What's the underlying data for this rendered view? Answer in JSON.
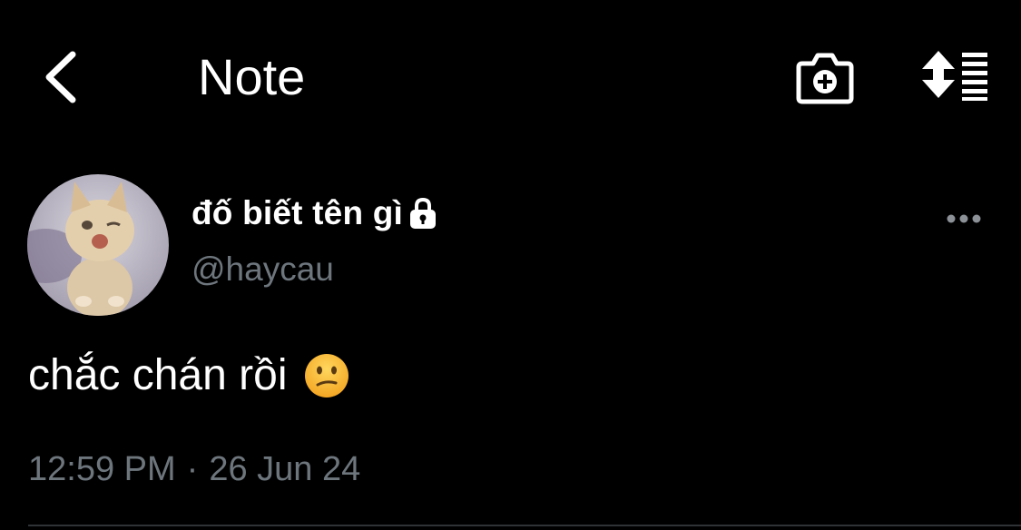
{
  "header": {
    "title": "Note",
    "back_icon": "chevron-left-icon",
    "camera_icon": "camera-plus-icon",
    "sort_icon": "sort-list-icon"
  },
  "author": {
    "display_name": "đố biết tên gì",
    "handle": "@haycau",
    "protected_icon": "lock-icon",
    "more_icon": "more-horizontal-icon"
  },
  "tweet": {
    "text": "chắc chán rồi",
    "emoji": "confused-face-emoji"
  },
  "meta": {
    "time": "12:59 PM",
    "separator": "·",
    "date": "26 Jun 24"
  },
  "colors": {
    "background": "#000000",
    "text": "#ffffff",
    "secondary": "#6e767d",
    "divider": "#2f3336"
  }
}
